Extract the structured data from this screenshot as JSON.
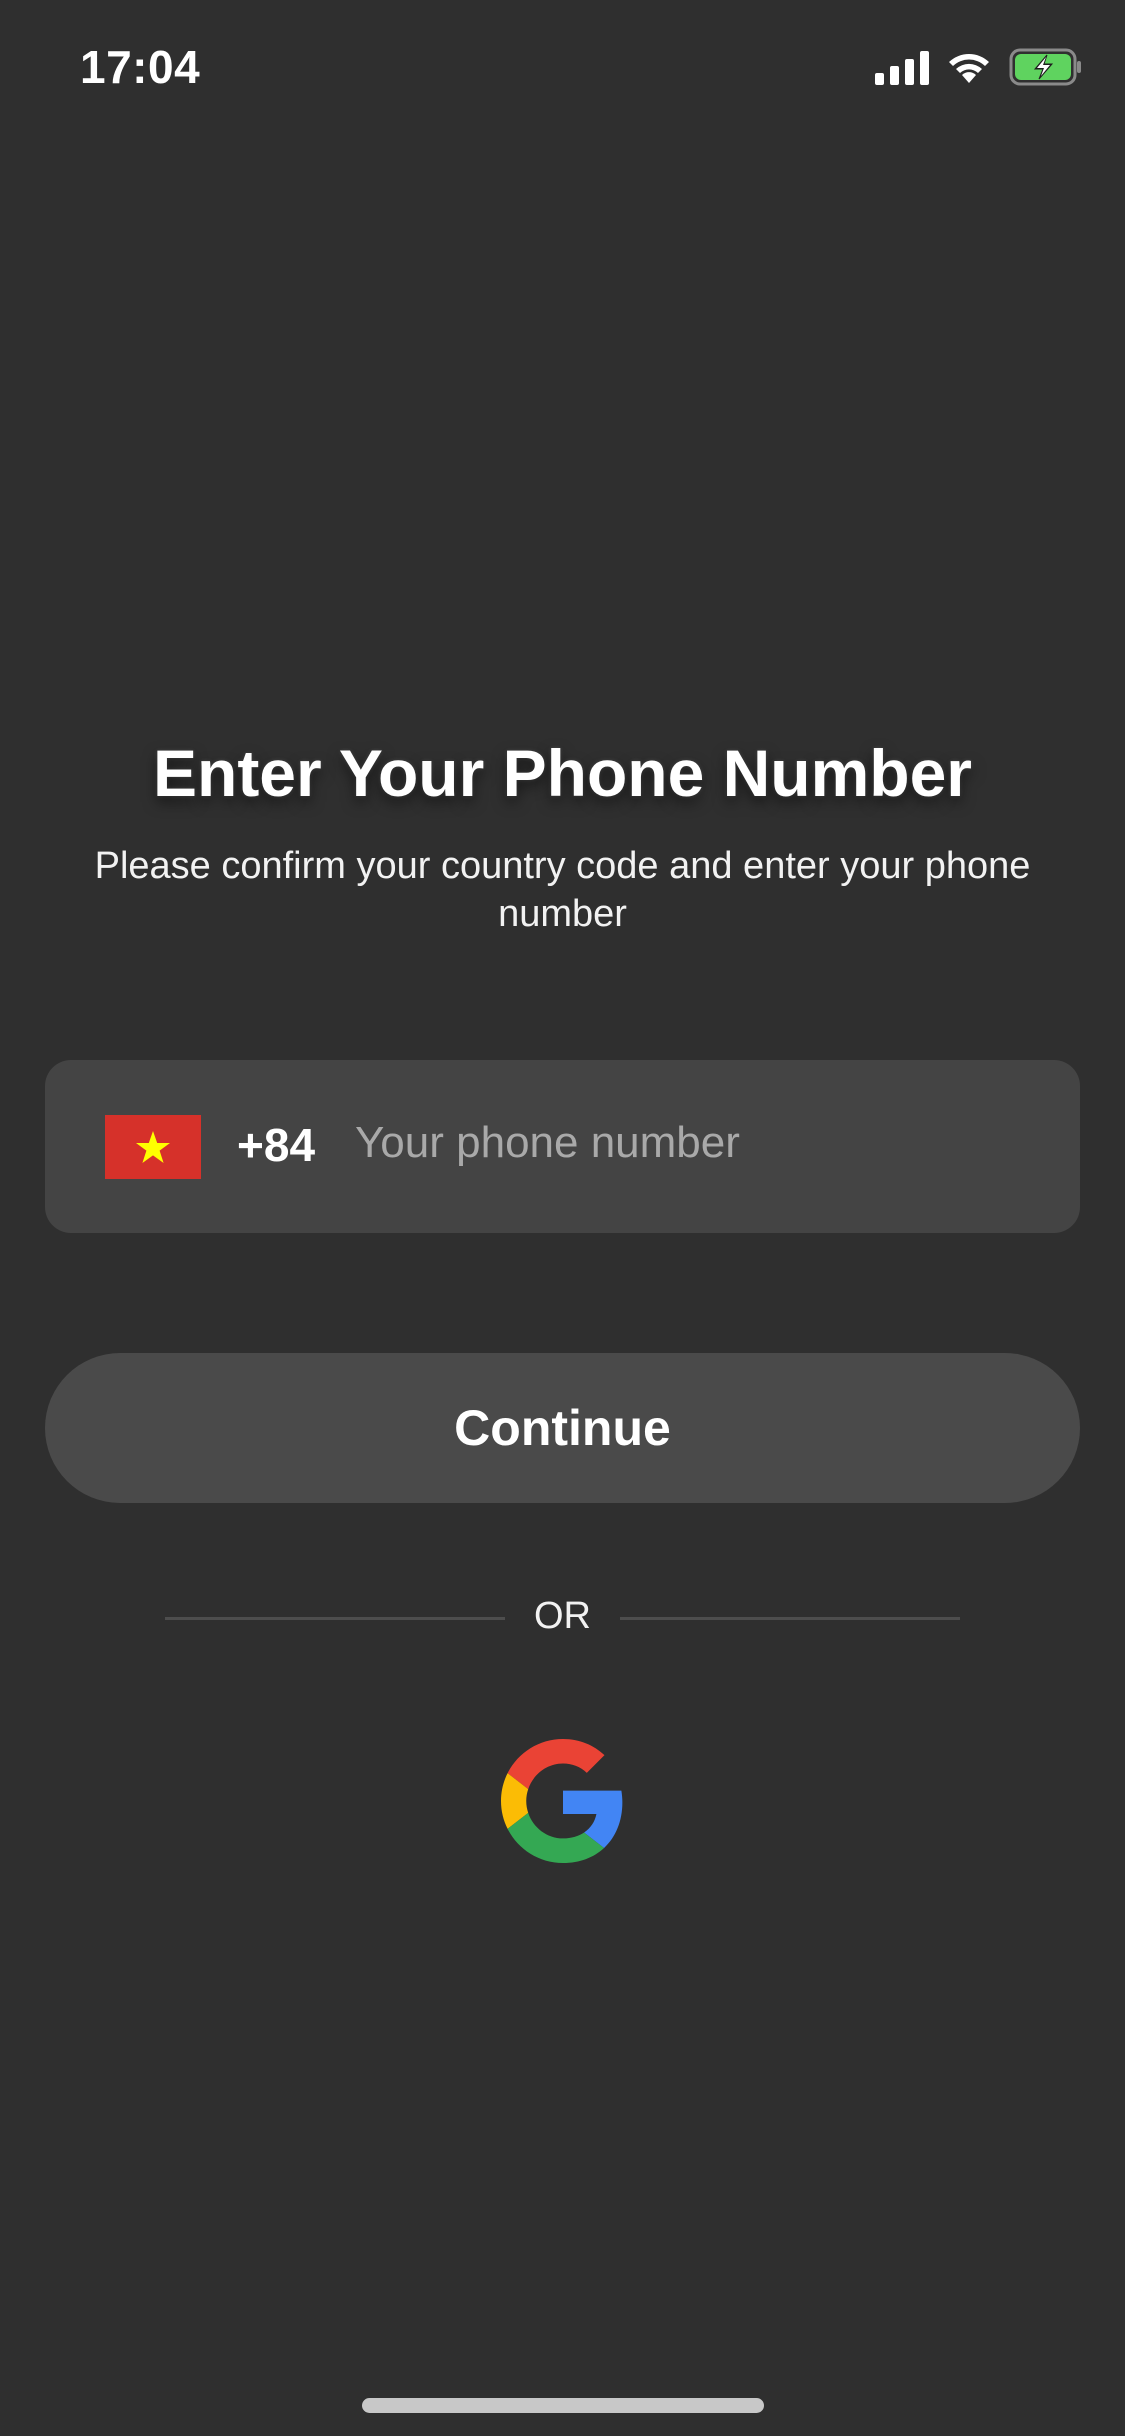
{
  "status_bar": {
    "time": "17:04",
    "icons": [
      "cellular-signal-icon",
      "wifi-icon",
      "battery-charging-icon"
    ],
    "battery_color": "#5fd35f"
  },
  "header": {
    "title": "Enter Your Phone Number",
    "subtitle": "Please confirm your country code and enter your phone number"
  },
  "phone_field": {
    "flag_icon": "vietnam-flag-icon",
    "country_code": "+84",
    "value": "",
    "placeholder": "Your phone number"
  },
  "actions": {
    "continue_label": "Continue",
    "divider_label": "OR",
    "google_icon": "google-logo-icon"
  },
  "colors": {
    "background": "#2f2f2f",
    "field_background": "#444444",
    "button_background": "#4a4a4a",
    "flag_red": "#d6312a",
    "flag_star": "#ffff00"
  }
}
